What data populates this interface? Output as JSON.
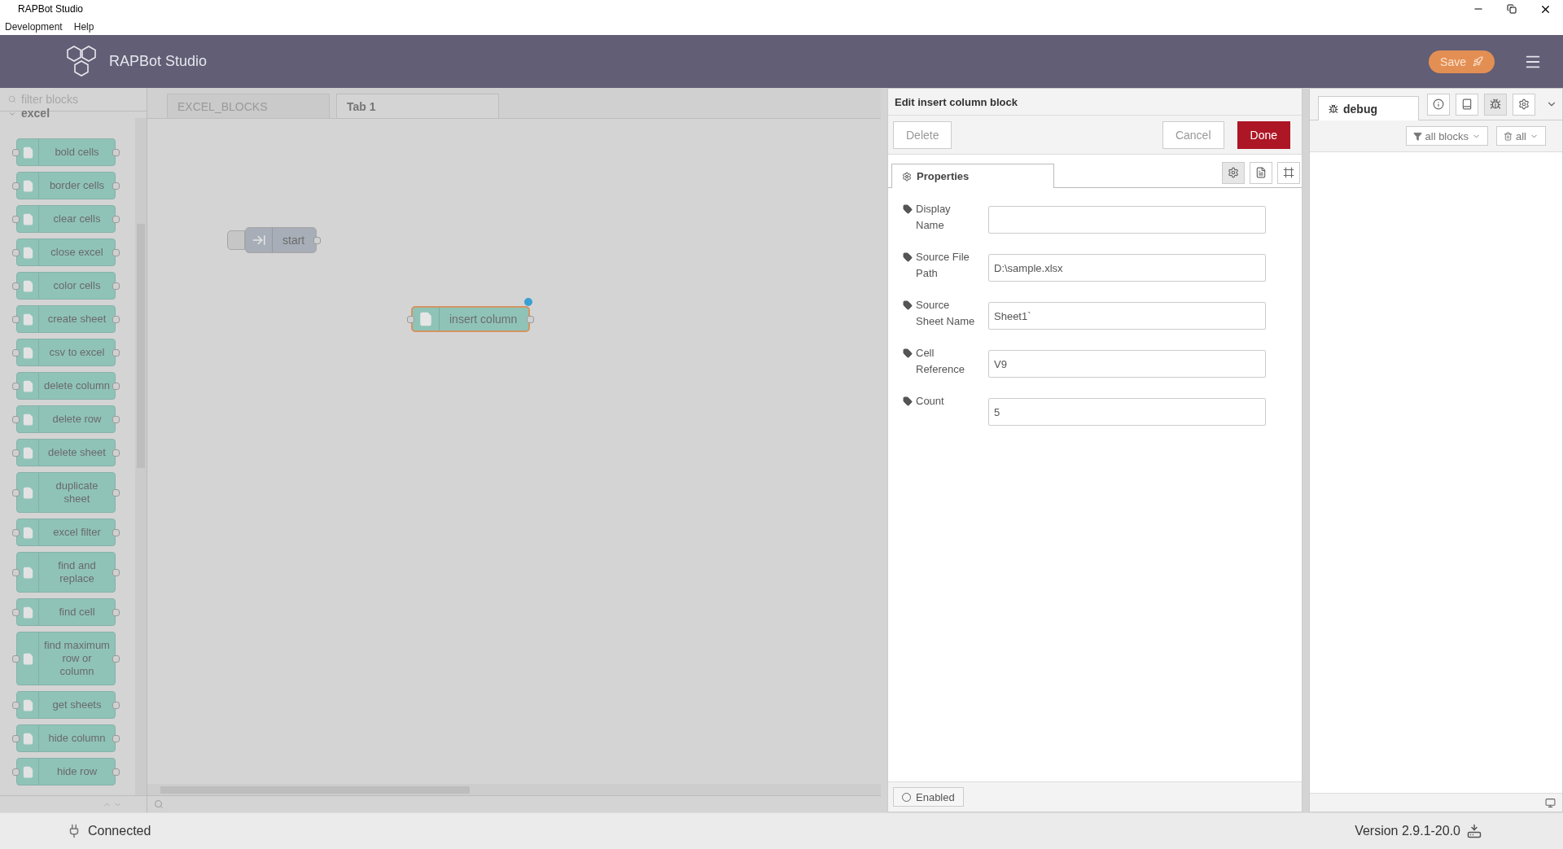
{
  "window": {
    "title": "RAPBot Studio"
  },
  "menu": [
    {
      "label": "Development"
    },
    {
      "label": "Help"
    }
  ],
  "header": {
    "title": "RAPBot Studio",
    "deploy_button": "Save"
  },
  "palette": {
    "search": {
      "placeholder": "filter blocks"
    },
    "category": {
      "label": "excel",
      "expanded": true
    },
    "blocks": [
      {
        "label": "bold cells"
      },
      {
        "label": "border cells"
      },
      {
        "label": "clear cells"
      },
      {
        "label": "close excel"
      },
      {
        "label": "color cells"
      },
      {
        "label": "create sheet"
      },
      {
        "label": "csv to excel"
      },
      {
        "label": "delete column"
      },
      {
        "label": "delete row"
      },
      {
        "label": "delete sheet"
      },
      {
        "label": "duplicate sheet"
      },
      {
        "label": "excel filter"
      },
      {
        "label": "find and replace"
      },
      {
        "label": "find cell"
      },
      {
        "label": "find maximum row or column"
      },
      {
        "label": "get sheets"
      },
      {
        "label": "hide column"
      },
      {
        "label": "hide row"
      }
    ]
  },
  "workspace_tabs": [
    {
      "label": "EXCEL_BLOCKS",
      "selected": false
    },
    {
      "label": "Tab 1",
      "selected": true
    }
  ],
  "canvas": {
    "nodes": [
      {
        "label": "start",
        "kind": "inject",
        "selected": false,
        "changed": false
      },
      {
        "label": "insert column",
        "kind": "excel",
        "selected": true,
        "changed": true
      }
    ]
  },
  "editor": {
    "title": "Edit insert column block",
    "buttons": [
      {
        "label": "Delete",
        "kind": "plain"
      },
      {
        "label": "Cancel",
        "kind": "plain"
      },
      {
        "label": "Done",
        "kind": "primary"
      }
    ],
    "tabs": [
      {
        "label": "Properties",
        "selected": true
      }
    ],
    "tab_tools": [
      {
        "kind": "settings",
        "selected": true
      },
      {
        "kind": "description",
        "selected": false
      },
      {
        "kind": "appearance",
        "selected": false
      }
    ],
    "fields": [
      {
        "label": "Display Name"
      },
      {
        "label": "Source File Path",
        "value": "D:\\sample.xlsx"
      },
      {
        "label": "Source Sheet Name",
        "value": "Sheet1`"
      },
      {
        "label": "Cell Reference",
        "value": "V9"
      },
      {
        "label": "Count",
        "value": "5"
      }
    ],
    "enabled": {
      "label": "Enabled",
      "on": false
    }
  },
  "sidebar": {
    "tabs": [
      {
        "label": "debug",
        "selected": true
      }
    ],
    "tools": [
      {
        "kind": "info",
        "selected": false
      },
      {
        "kind": "help",
        "selected": false
      },
      {
        "kind": "debug",
        "selected": true
      },
      {
        "kind": "config",
        "selected": false
      }
    ],
    "filters": [
      {
        "label": "all blocks",
        "kind": "filter"
      },
      {
        "label": "all",
        "kind": "clear"
      }
    ]
  },
  "status_bar": {
    "connection": "Connected",
    "version": "Version 2.9.1-20.0"
  }
}
